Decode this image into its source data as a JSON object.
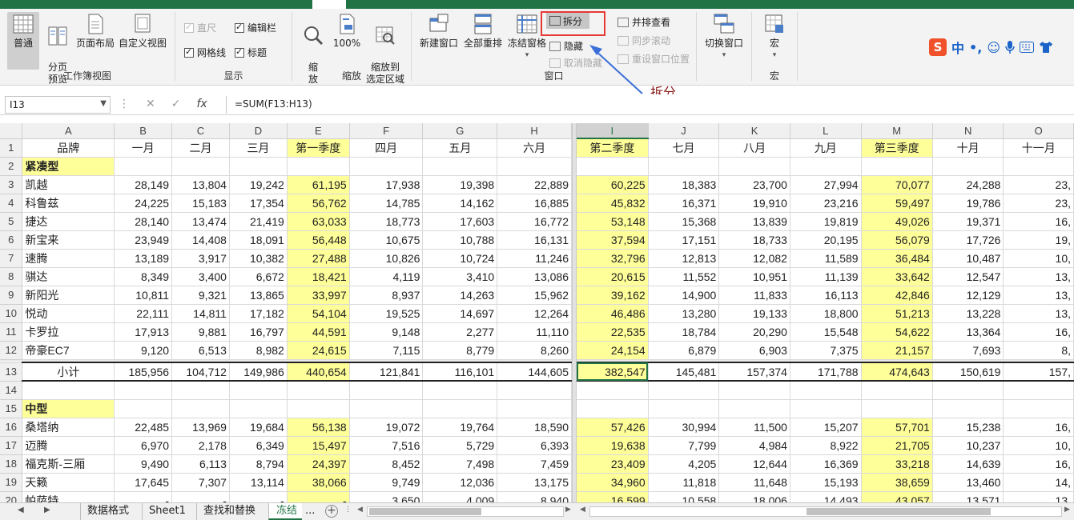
{
  "ribbon": {
    "workbook_views": {
      "group_label": "工作簿视图",
      "normal": "普通",
      "page_break": "分页\n预览",
      "page_layout": "页面布局",
      "custom_views": "自定义视图"
    },
    "show": {
      "group_label": "显示",
      "ruler": "直尺",
      "formula_bar": "编辑栏",
      "gridlines": "网格线",
      "headings": "标题"
    },
    "zoom": {
      "group_label": "缩放",
      "zoom": "缩\n放",
      "hundred": "100%",
      "zoom_to_selection": "缩放到\n选定区域"
    },
    "window": {
      "group_label": "窗口",
      "new_window": "新建窗口",
      "arrange_all": "全部重排",
      "freeze_panes": "冻结窗格",
      "split": "拆分",
      "hide": "隐藏",
      "unhide": "取消隐藏",
      "side_by_side": "并排查看",
      "sync_scroll": "同步滚动",
      "reset_position": "重设窗口位置",
      "switch_windows": "切换窗口"
    },
    "macros": {
      "group_label": "宏",
      "macros": "宏"
    }
  },
  "ime": {
    "lang": "中",
    "punct": "•,"
  },
  "annotation": {
    "label": "拆分",
    "color": "#8b1a1a",
    "arrow_color": "#3a6fd8"
  },
  "formula_bar": {
    "name_box": "I13",
    "formula": "=SUM(F13:H13)"
  },
  "left_columns": [
    "A",
    "B",
    "C",
    "D",
    "E",
    "F",
    "G",
    "H"
  ],
  "right_columns": [
    "I",
    "J",
    "K",
    "L",
    "M",
    "N",
    "O"
  ],
  "header_row": {
    "left": [
      "品牌",
      "一月",
      "二月",
      "三月",
      "第一季度",
      "四月",
      "五月",
      "六月"
    ],
    "right": [
      "第二季度",
      "七月",
      "八月",
      "九月",
      "第三季度",
      "十月",
      "十一月"
    ]
  },
  "rows_top": [
    {
      "n": "2",
      "cat": "紧凑型"
    },
    {
      "n": "3",
      "left": [
        "凯越",
        "28,149",
        "13,804",
        "19,242",
        "61,195",
        "17,938",
        "19,398",
        "22,889"
      ],
      "right": [
        "60,225",
        "18,383",
        "23,700",
        "27,994",
        "70,077",
        "24,288",
        "23,"
      ]
    },
    {
      "n": "4",
      "left": [
        "科鲁兹",
        "24,225",
        "15,183",
        "17,354",
        "56,762",
        "14,785",
        "14,162",
        "16,885"
      ],
      "right": [
        "45,832",
        "16,371",
        "19,910",
        "23,216",
        "59,497",
        "19,786",
        "23,"
      ]
    },
    {
      "n": "5",
      "left": [
        "捷达",
        "28,140",
        "13,474",
        "21,419",
        "63,033",
        "18,773",
        "17,603",
        "16,772"
      ],
      "right": [
        "53,148",
        "15,368",
        "13,839",
        "19,819",
        "49,026",
        "19,371",
        "16,"
      ]
    },
    {
      "n": "6",
      "left": [
        "新宝来",
        "23,949",
        "14,408",
        "18,091",
        "56,448",
        "10,675",
        "10,788",
        "16,131"
      ],
      "right": [
        "37,594",
        "17,151",
        "18,733",
        "20,195",
        "56,079",
        "17,726",
        "19,"
      ]
    },
    {
      "n": "7",
      "left": [
        "速腾",
        "13,189",
        "3,917",
        "10,382",
        "27,488",
        "10,826",
        "10,724",
        "11,246"
      ],
      "right": [
        "32,796",
        "12,813",
        "12,082",
        "11,589",
        "36,484",
        "10,487",
        "10,"
      ]
    },
    {
      "n": "8",
      "left": [
        "骐达",
        "8,349",
        "3,400",
        "6,672",
        "18,421",
        "4,119",
        "3,410",
        "13,086"
      ],
      "right": [
        "20,615",
        "11,552",
        "10,951",
        "11,139",
        "33,642",
        "12,547",
        "13,"
      ]
    },
    {
      "n": "9",
      "left": [
        "新阳光",
        "10,811",
        "9,321",
        "13,865",
        "33,997",
        "8,937",
        "14,263",
        "15,962"
      ],
      "right": [
        "39,162",
        "14,900",
        "11,833",
        "16,113",
        "42,846",
        "12,129",
        "13,"
      ]
    },
    {
      "n": "10",
      "left": [
        "悦动",
        "22,111",
        "14,811",
        "17,182",
        "54,104",
        "19,525",
        "14,697",
        "12,264"
      ],
      "right": [
        "46,486",
        "13,280",
        "19,133",
        "18,800",
        "51,213",
        "13,228",
        "13,"
      ]
    },
    {
      "n": "11",
      "left": [
        "卡罗拉",
        "17,913",
        "9,881",
        "16,797",
        "44,591",
        "9,148",
        "2,277",
        "11,110"
      ],
      "right": [
        "22,535",
        "18,784",
        "20,290",
        "15,548",
        "54,622",
        "13,364",
        "16,"
      ]
    },
    {
      "n": "12",
      "left": [
        "帝豪EC7",
        "9,120",
        "6,513",
        "8,982",
        "24,615",
        "7,115",
        "8,779",
        "8,260"
      ],
      "right": [
        "24,154",
        "6,879",
        "6,903",
        "7,375",
        "21,157",
        "7,693",
        "8,"
      ]
    }
  ],
  "rows_bottom": [
    {
      "n": "13",
      "total": true,
      "left": [
        "小计",
        "185,956",
        "104,712",
        "149,986",
        "440,654",
        "121,841",
        "116,101",
        "144,605"
      ],
      "right": [
        "382,547",
        "145,481",
        "157,374",
        "171,788",
        "474,643",
        "150,619",
        "157,"
      ]
    },
    {
      "n": "14",
      "empty": true
    },
    {
      "n": "15",
      "cat": "中型"
    },
    {
      "n": "16",
      "left": [
        "桑塔纳",
        "22,485",
        "13,969",
        "19,684",
        "56,138",
        "19,072",
        "19,764",
        "18,590"
      ],
      "right": [
        "57,426",
        "30,994",
        "11,500",
        "15,207",
        "57,701",
        "15,238",
        "16,"
      ]
    },
    {
      "n": "17",
      "left": [
        "迈腾",
        "6,970",
        "2,178",
        "6,349",
        "15,497",
        "7,516",
        "5,729",
        "6,393"
      ],
      "right": [
        "19,638",
        "7,799",
        "4,984",
        "8,922",
        "21,705",
        "10,237",
        "10,"
      ]
    },
    {
      "n": "18",
      "left": [
        "福克斯-三厢",
        "9,490",
        "6,113",
        "8,794",
        "24,397",
        "8,452",
        "7,498",
        "7,459"
      ],
      "right": [
        "23,409",
        "4,205",
        "12,644",
        "16,369",
        "33,218",
        "14,639",
        "16,"
      ]
    },
    {
      "n": "19",
      "left": [
        "天籁",
        "17,645",
        "7,307",
        "13,114",
        "38,066",
        "9,749",
        "12,036",
        "13,175"
      ],
      "right": [
        "34,960",
        "11,818",
        "11,648",
        "15,193",
        "38,659",
        "13,460",
        "14,"
      ]
    },
    {
      "n": "20",
      "left": [
        "帕萨特",
        "-",
        "-",
        "-",
        "-",
        "3,650",
        "4,009",
        "8,940"
      ],
      "right": [
        "16,599",
        "10,558",
        "18,006",
        "14,493",
        "43,057",
        "13,571",
        "13,"
      ]
    }
  ],
  "sheet_tabs": [
    "数据格式",
    "Sheet1",
    "查找和替换",
    "冻结",
    "..."
  ],
  "colors": {
    "excel_green": "#217346",
    "quarter_yellow": "#ffff99",
    "highlight_red": "#e53935"
  }
}
